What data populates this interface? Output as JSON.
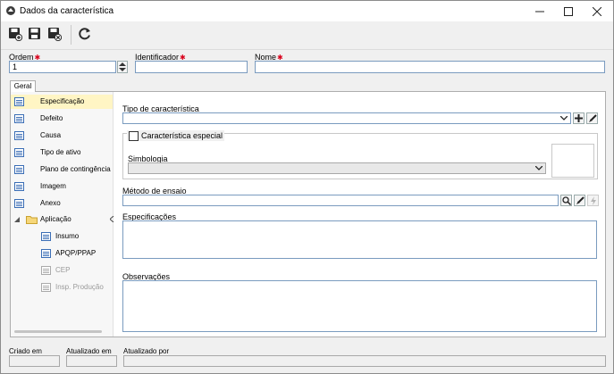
{
  "window": {
    "title": "Dados da característica",
    "icon": "app-logo-icon",
    "controls": [
      "minimize-icon",
      "maximize-icon",
      "close-icon"
    ]
  },
  "toolbar": {
    "buttons": [
      {
        "name": "save-new-button",
        "icon": "save-new-icon"
      },
      {
        "name": "save-button",
        "icon": "save-icon"
      },
      {
        "name": "save-close-button",
        "icon": "save-close-icon"
      },
      {
        "name": "refresh-button",
        "icon": "refresh-icon"
      }
    ]
  },
  "header": {
    "ordem_label": "Ordem",
    "ordem_value": "1",
    "identificador_label": "Identificador",
    "identificador_value": "",
    "nome_label": "Nome",
    "nome_value": ""
  },
  "tab": {
    "label": "Geral"
  },
  "tree": {
    "items": [
      {
        "label": "Especificação",
        "selected": true,
        "disabled": false
      },
      {
        "label": "Defeito",
        "selected": false,
        "disabled": false
      },
      {
        "label": "Causa",
        "selected": false,
        "disabled": false
      },
      {
        "label": "Tipo de ativo",
        "selected": false,
        "disabled": false
      },
      {
        "label": "Plano de contingência",
        "selected": false,
        "disabled": false
      },
      {
        "label": "Imagem",
        "selected": false,
        "disabled": false
      },
      {
        "label": "Anexo",
        "selected": false,
        "disabled": false
      },
      {
        "label": "Aplicação",
        "selected": false,
        "disabled": false
      },
      {
        "label": "Insumo",
        "selected": false,
        "disabled": false
      },
      {
        "label": "APQP/PPAP",
        "selected": false,
        "disabled": false
      },
      {
        "label": "CEP",
        "selected": false,
        "disabled": true
      },
      {
        "label": "Insp. Produção",
        "selected": false,
        "disabled": true
      }
    ]
  },
  "form": {
    "tipo_label": "Tipo de característica",
    "tipo_value": "",
    "especial_label": "Característica especial",
    "especial_checked": false,
    "simbologia_label": "Simbologia",
    "simbologia_value": "",
    "metodo_label": "Método de ensaio",
    "metodo_value": "",
    "especificacoes_label": "Especificações",
    "especificacoes_value": "",
    "observacoes_label": "Observações",
    "observacoes_value": ""
  },
  "footer": {
    "criado_label": "Criado em",
    "atualizado_em_label": "Atualizado em",
    "atualizado_por_label": "Atualizado por",
    "criado_value": "",
    "atualizado_em_value": "",
    "atualizado_por_value": ""
  },
  "colors": {
    "required": "#d9001b",
    "selected_row": "#fff5c4",
    "input_border": "#7a9bbf"
  }
}
